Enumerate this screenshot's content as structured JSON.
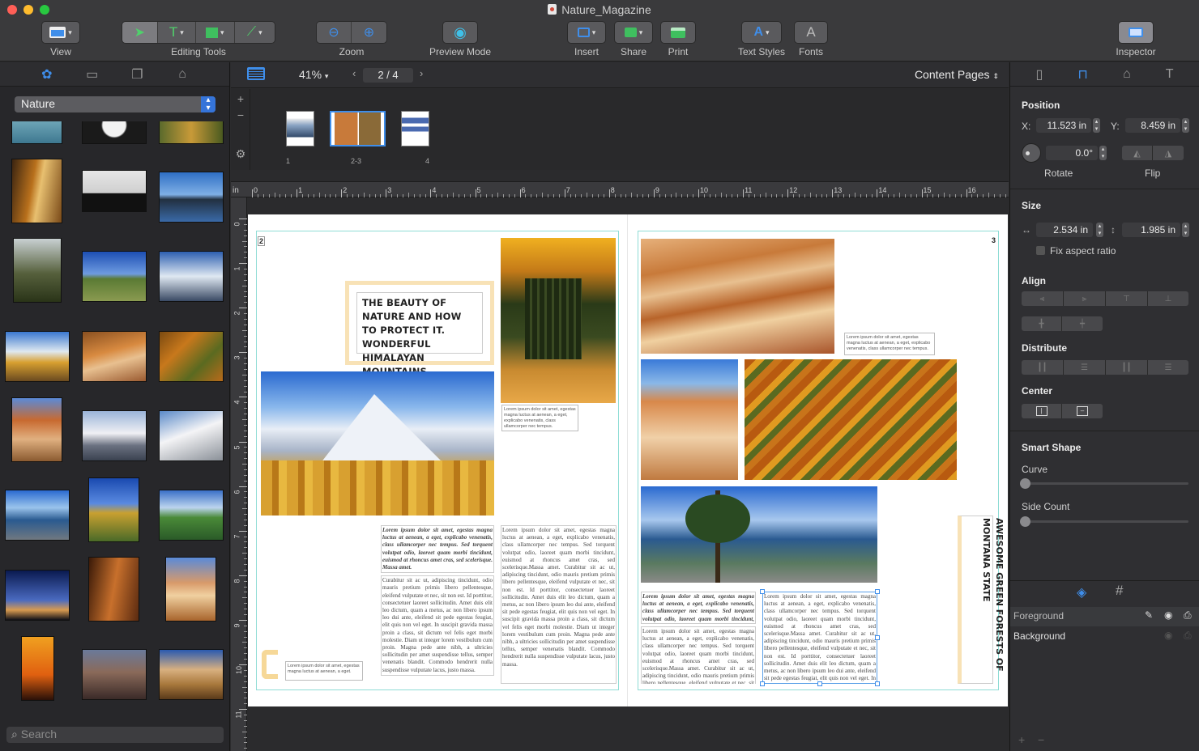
{
  "window": {
    "title": "Nature_Magazine"
  },
  "toolbar": {
    "view": "View",
    "editing_tools": "Editing Tools",
    "zoom": "Zoom",
    "preview_mode": "Preview Mode",
    "insert": "Insert",
    "share": "Share",
    "print": "Print",
    "text_styles": "Text Styles",
    "fonts": "Fonts",
    "inspector": "Inspector"
  },
  "library": {
    "category": "Nature",
    "search_placeholder": "Search"
  },
  "canvas_bar": {
    "zoom_value": "41%",
    "page_indicator": "2 / 4",
    "content_pages": "Content Pages"
  },
  "page_thumbs": [
    {
      "label": "1"
    },
    {
      "label": "2-3"
    },
    {
      "label": "4"
    }
  ],
  "ruler": {
    "unit": "in",
    "h_ticks": [
      "0",
      "1",
      "2",
      "3",
      "4",
      "5",
      "6",
      "7",
      "8",
      "9",
      "10",
      "11",
      "12",
      "13",
      "14",
      "15",
      "16"
    ],
    "v_ticks": [
      "0",
      "1",
      "2",
      "3",
      "4",
      "5",
      "6",
      "7",
      "8",
      "9",
      "10",
      "11"
    ]
  },
  "spread": {
    "left_page_number": "2",
    "right_page_number": "3",
    "headline": "THE BEAUTY OF NATURE AND HOW TO PROTECT IT. WONDERFUL HIMALAYAN MOUNTAINS",
    "vertical_headline": "AWESOME GREEN FORESTS OF MONTANA STATE",
    "caption": "Lorem ipsum dolor sit amet, egestas magna luctus at aenean, a eget, explicabo venenatis, class ullamcorper nec tempus.",
    "caption_short": "Lorem ipsum dolor sit amet, egestas magna luctus at aenean, a eget.",
    "body_bold": "Lorem ipsum dolor sit amet, egestas magna luctus at aenean, a eget, explicabo venenatis, class ullamcorper nec tempus. Sed torquent volutpat odio, laoreet quam morbi tincidunt, euismod at rhoncus amet cras, sed scelerisque. Massa amet.",
    "body": "Curabitur sit ac ut, adipiscing tincidunt, odio mauris pretium primis libero pellentesque, eleifend vulputate et nec, sit non est. Id porttitor, consectetuer laoreet sollicitudin. Amet duis elit leo dictum, quam a metus, ac non libero ipsum leo dui ante, eleifend sit pede egestas feugiat, elit quis non vel eget. In suscipit gravida massa proin a class, sit dictum vel felis eget morbi molestie. Diam ut integer lorem vestibulum cum proin. Magna pede ante nibh, a ultricies sollicitudin per amet suspendisse tellus, semper venenatis blandit. Commodo hendrerit nulla suspendisse vulputate lacus, justo massa.",
    "body2": "Lorem ipsum dolor sit amet, egestas magna luctus at aenean, a eget, explicabo venenatis, class ullamcorper nec tempus. Sed torquent volutpat odio, laoreet quam morbi tincidunt, euismod at rhoncus amet cras, sed scelerisque.Massa amet. Curabitur sit ac ut, adipiscing tincidunt, odio mauris pretium primis libero pellentesque, eleifend vulputate et nec, sit non est. Id porttitor, consectetuer laoreet sollicitudin. Amet duis elit leo dictum, quam a metus, ac non libero ipsum leo dui ante, eleifend sit pede egestas feugiat, elit quis non vel eget. In suscipit gravida massa proin a class, sit dictum vel felis eget morbi molestie. Diam ut integer lorem vestibulum cum proin. Magna pede ante nibh, a ultricies sollicitudin per amet suspendisse tellus, semper venenatis blandit. Commodo hendrerit nulla suspendisse vulputate lacus, justo massa."
  },
  "inspector": {
    "position": "Position",
    "x_label": "X:",
    "x_value": "11.523 in",
    "y_label": "Y:",
    "y_value": "8.459 in",
    "rotate_value": "0.0°",
    "rotate": "Rotate",
    "flip": "Flip",
    "size": "Size",
    "width_value": "2.534 in",
    "height_value": "1.985 in",
    "fix_aspect": "Fix aspect ratio",
    "align": "Align",
    "distribute": "Distribute",
    "center": "Center",
    "smart_shape": "Smart Shape",
    "curve": "Curve",
    "side_count": "Side Count",
    "curve_value": 0,
    "side_count_value": 0
  },
  "layers": [
    {
      "name": "Foreground"
    },
    {
      "name": "Background"
    }
  ],
  "colors": {
    "accent": "#3f8eea",
    "frame": "#8fdcd5",
    "headline_border": "#f8e2b6"
  }
}
